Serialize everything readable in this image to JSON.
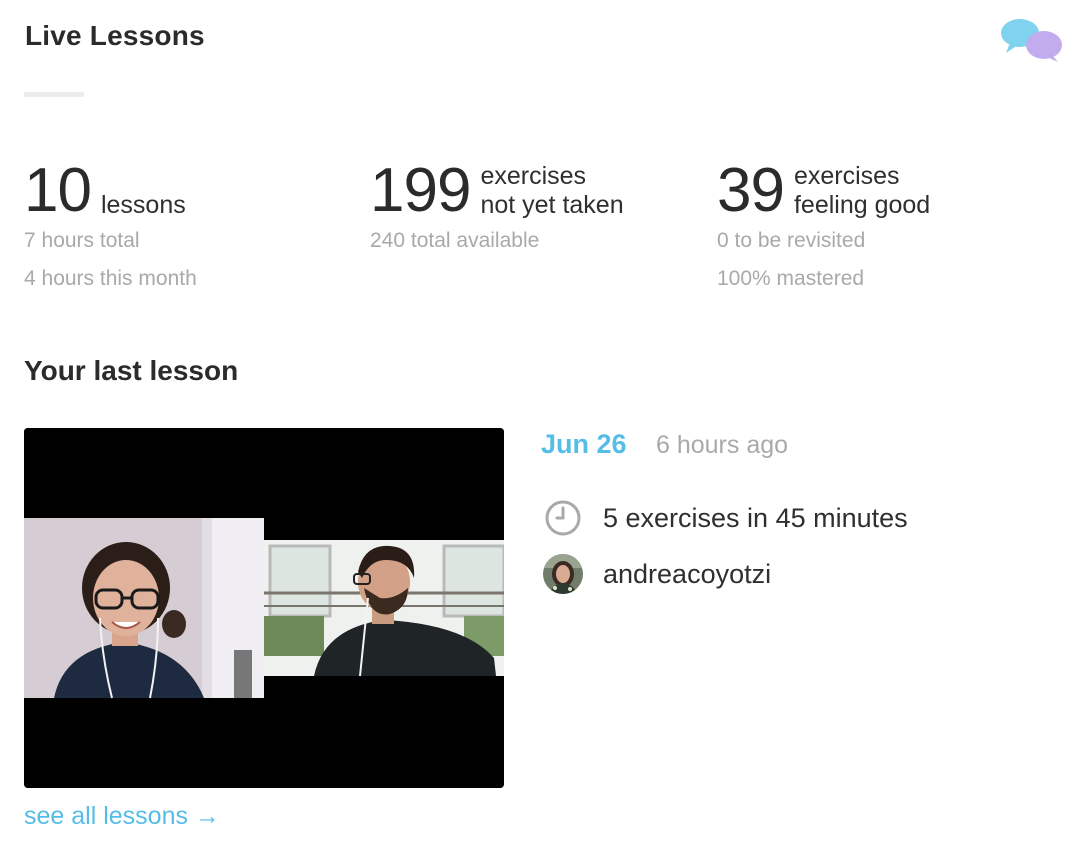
{
  "header": {
    "title": "Live Lessons",
    "icon": "chat-bubbles-icon",
    "icon_colors": [
      "#7fd3ef",
      "#c3acee"
    ]
  },
  "stats": [
    {
      "number": "10",
      "unit": "lessons",
      "sub": [
        "7 hours total",
        "4 hours this month"
      ]
    },
    {
      "number": "199",
      "unit_line1": "exercises",
      "unit_line2": "not yet taken",
      "sub": [
        "240 total available"
      ]
    },
    {
      "number": "39",
      "unit_line1": "exercises",
      "unit_line2": "feeling good",
      "sub": [
        "0 to be revisited",
        "100% mastered"
      ]
    }
  ],
  "last_lesson": {
    "section_title": "Your last lesson",
    "date": "Jun 26",
    "time_ago": "6 hours ago",
    "exercises_summary": "5 exercises in 45 minutes",
    "teacher": "andreacoyotzi",
    "clock_icon": "clock-icon",
    "see_all": "see all lessons →"
  },
  "colors": {
    "accent": "#55bde6",
    "muted_text": "#a9a9a9",
    "text": "#2f2f2f"
  }
}
